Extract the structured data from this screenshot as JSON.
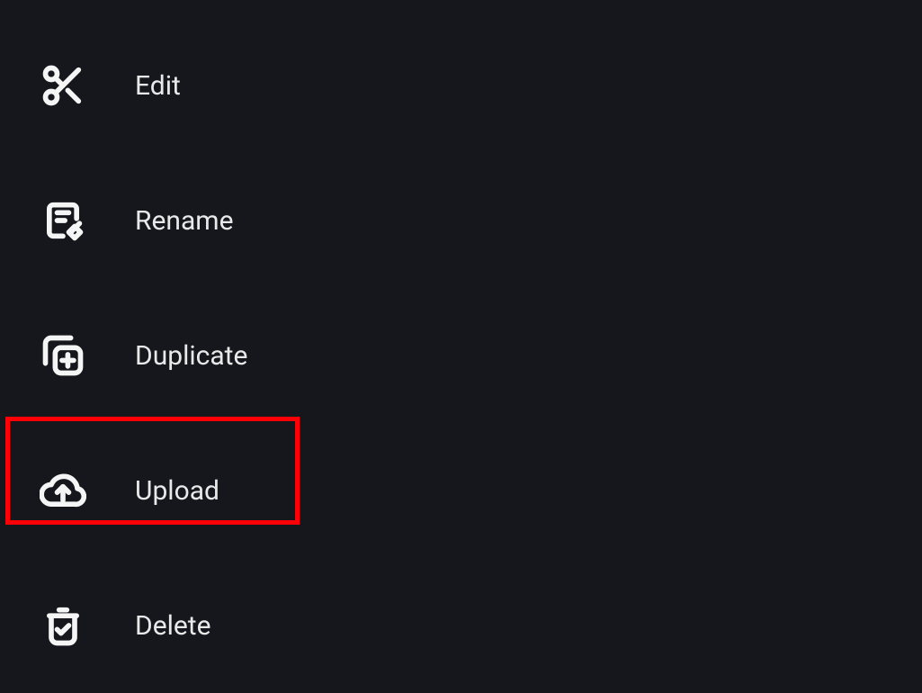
{
  "menu": {
    "items": [
      {
        "label": "Edit"
      },
      {
        "label": "Rename"
      },
      {
        "label": "Duplicate"
      },
      {
        "label": "Upload"
      },
      {
        "label": "Delete"
      }
    ]
  }
}
